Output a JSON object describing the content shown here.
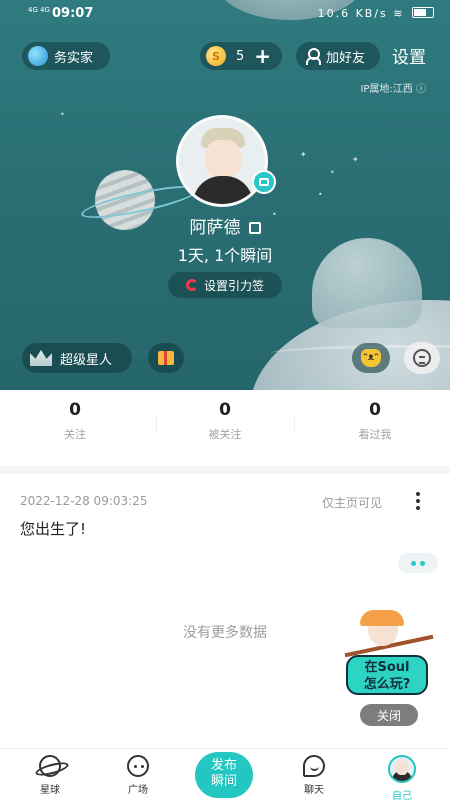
{
  "status_bar": {
    "signal": "4G 4G",
    "time": "09:07",
    "network_speed": "10.6 KB/s"
  },
  "header": {
    "badge_label": "务实家",
    "coin_count": "5",
    "coin_plus": "+",
    "add_friend_label": "加好友",
    "settings_label": "设置",
    "ip_location": "IP属地:江西"
  },
  "profile": {
    "name": "阿萨德",
    "summary": "1天, 1个瞬间",
    "gravity_tag_label": "设置引力签",
    "super_star_label": "超级星人"
  },
  "stats": [
    {
      "value": "0",
      "label": "关注"
    },
    {
      "value": "0",
      "label": "被关注"
    },
    {
      "value": "0",
      "label": "看过我"
    }
  ],
  "post": {
    "date": "2022-12-28 09:03:25",
    "visibility": "仅主页可见",
    "text": "您出生了!"
  },
  "feed": {
    "no_more": "没有更多数据"
  },
  "promo": {
    "line1": "在Soul",
    "line2": "怎么玩?",
    "close_label": "关闭"
  },
  "nav": {
    "items": [
      {
        "label": "星球",
        "icon": "planet-icon"
      },
      {
        "label": "广场",
        "icon": "square-icon"
      },
      {
        "label": "聊天",
        "icon": "chat-icon"
      },
      {
        "label": "自己",
        "icon": "avatar-icon"
      }
    ],
    "publish_line1": "发布",
    "publish_line2": "瞬间",
    "active_color": "#25c4c4"
  },
  "colors": {
    "accent": "#23c6c0",
    "hero_bg": "#2a6f74"
  }
}
